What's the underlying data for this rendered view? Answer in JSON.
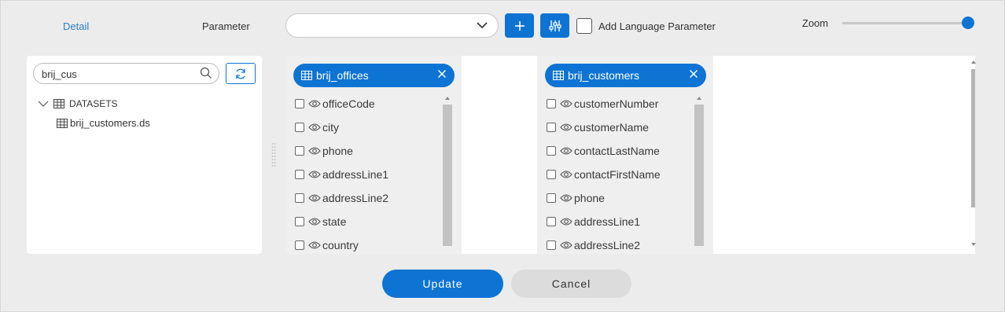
{
  "toolbar": {
    "detail_tab": "Detail",
    "parameter_label": "Parameter",
    "parameter_value": "",
    "add_language_label": "Add Language Parameter",
    "add_language_checked": false,
    "zoom_label": "Zoom",
    "zoom_level": 1.0
  },
  "left_panel": {
    "search_value": "brij_cus",
    "tree": {
      "root_label": "DATASETS",
      "children": [
        "brij_customers.ds"
      ]
    }
  },
  "datasets": [
    {
      "title": "brij_offices",
      "fields": [
        "officeCode",
        "city",
        "phone",
        "addressLine1",
        "addressLine2",
        "state",
        "country"
      ]
    },
    {
      "title": "brij_customers",
      "fields": [
        "customerNumber",
        "customerName",
        "contactLastName",
        "contactFirstName",
        "phone",
        "addressLine1",
        "addressLine2"
      ]
    }
  ],
  "footer": {
    "update_label": "Update",
    "cancel_label": "Cancel"
  },
  "colors": {
    "accent": "#0d74d4",
    "background": "#ececec",
    "card": "#efefef"
  },
  "icons": [
    "search-icon",
    "refresh-icon",
    "chevron-down-icon",
    "plus-icon",
    "tune-icon",
    "table-icon",
    "eye-icon",
    "close-icon",
    "caret-up-icon"
  ]
}
